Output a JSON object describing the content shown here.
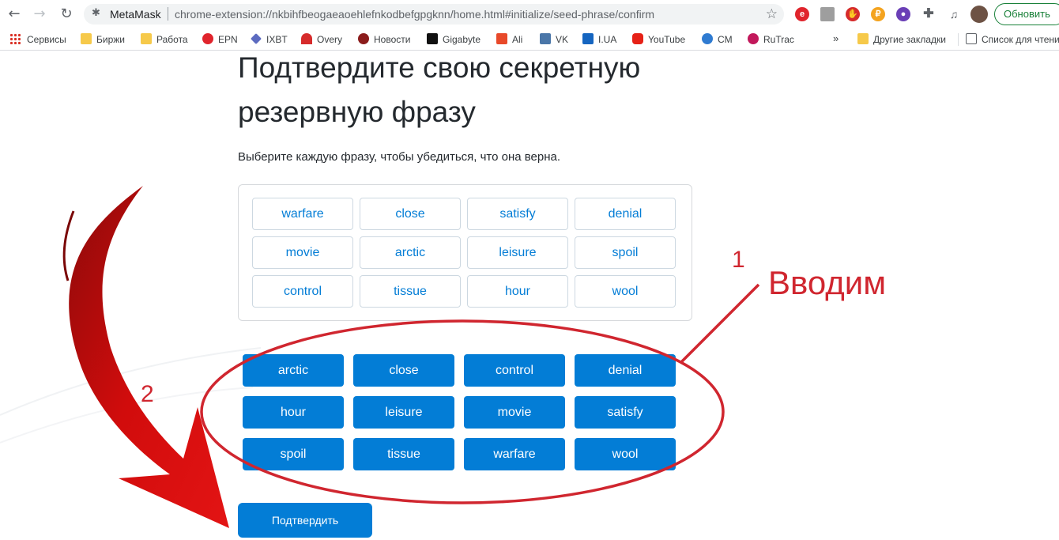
{
  "browser": {
    "site_name": "MetaMask",
    "url": "chrome-extension://nkbihfbeogaeaoehlefnkodbefgpgknn/home.html#initialize/seed-phrase/confirm",
    "update_label": "Обновить",
    "extension_icons": [
      "epn-icon",
      "screenshot-icon",
      "adblock-icon",
      "coin-icon",
      "profile-ext-icon",
      "puzzle-icon",
      "media-icon",
      "avatar"
    ],
    "bookmarks": [
      {
        "label": "Сервисы",
        "icon": "apps-icon"
      },
      {
        "label": "Биржи",
        "icon": "folder-icon"
      },
      {
        "label": "Работа",
        "icon": "folder-icon"
      },
      {
        "label": "EPN",
        "icon": "epn-icon"
      },
      {
        "label": "IXBT",
        "icon": "ixbt-icon"
      },
      {
        "label": "Overy",
        "icon": "overy-icon"
      },
      {
        "label": "Новости",
        "icon": "news-icon"
      },
      {
        "label": "Gigabyte",
        "icon": "gigabyte-icon"
      },
      {
        "label": "Ali",
        "icon": "ali-icon"
      },
      {
        "label": "VK",
        "icon": "vk-icon"
      },
      {
        "label": "I.UA",
        "icon": "iua-icon"
      },
      {
        "label": "YouTube",
        "icon": "youtube-icon"
      },
      {
        "label": "CM",
        "icon": "cm-icon"
      },
      {
        "label": "RuTrac",
        "icon": "rutracker-icon"
      }
    ],
    "more_bookmarks": "»",
    "other_bookmarks": "Другие закладки",
    "reading_list": "Список для чтени"
  },
  "page": {
    "title_line1": "Подтвердите свою секретную",
    "title_line2": "резервную фразу",
    "subtitle": "Выберите каждую фразу, чтобы убедиться, что она верна.",
    "seed_words": [
      "warfare",
      "close",
      "satisfy",
      "denial",
      "movie",
      "arctic",
      "leisure",
      "spoil",
      "control",
      "tissue",
      "hour",
      "wool"
    ],
    "selected_words": [
      "arctic",
      "close",
      "control",
      "denial",
      "hour",
      "leisure",
      "movie",
      "satisfy",
      "spoil",
      "tissue",
      "warfare",
      "wool"
    ],
    "confirm_label": "Подтвердить"
  },
  "annotations": {
    "step1": "1",
    "step1_label": "Вводим",
    "step2": "2",
    "color": "#d0262f"
  },
  "colors": {
    "accent": "#037dd6",
    "update_green": "#188038"
  }
}
